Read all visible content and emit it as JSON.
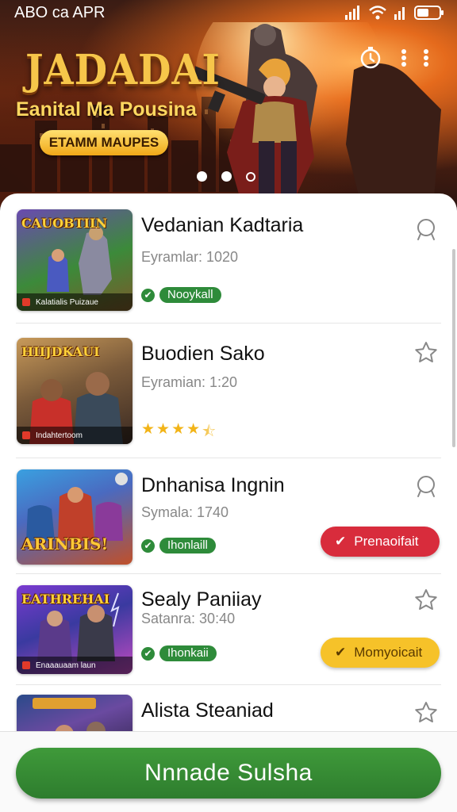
{
  "status_bar": {
    "time": "ABO ca APR"
  },
  "hero": {
    "title": "JADADAI",
    "subtitle": "Eanital Ma Pousina",
    "cta_label": "ETAMM MAUPES",
    "slides": 3,
    "active_slide": 1
  },
  "items": [
    {
      "title": "Vedanian Kadtaria",
      "meta": "Eyramlar: 1020",
      "thumb_label": "CAUOBTIIN",
      "thumb_footer": "Kalatialis Puizaue",
      "badge": "Nooykall",
      "favorite_icon": "award-icon"
    },
    {
      "title": "Buodien Sako",
      "meta": "Eyramian: 1:20",
      "thumb_label": "HIIJDKAUI",
      "thumb_footer": "Indahtertoom",
      "rating_stars": 4.5,
      "favorite_icon": "star-icon"
    },
    {
      "title": "Dnhanisa Ingnin",
      "meta": "Symala: 1740",
      "thumb_label": "ARINBIS!",
      "thumb_footer": "",
      "badge": "Ihonlaill",
      "status_button": "Prenaoifait",
      "favorite_icon": "award-icon"
    },
    {
      "title": "Sealy Paniiay",
      "meta": "Satanra: 30:40",
      "thumb_label": "EATHREHAI",
      "thumb_footer": "Enaaauaam laun",
      "badge": "Ihonkaii",
      "status_button": "Momyoicait",
      "favorite_icon": "star-icon"
    },
    {
      "title": "Alista Steaniad",
      "meta": "",
      "thumb_label": "",
      "favorite_icon": "star-icon"
    }
  ],
  "bottom": {
    "primary_label": "Nnnade Sulsha"
  },
  "colors": {
    "accent_green": "#2e8b3a",
    "status_red": "#d82c3c",
    "status_yellow": "#f6c229",
    "star_gold": "#f2b418"
  }
}
